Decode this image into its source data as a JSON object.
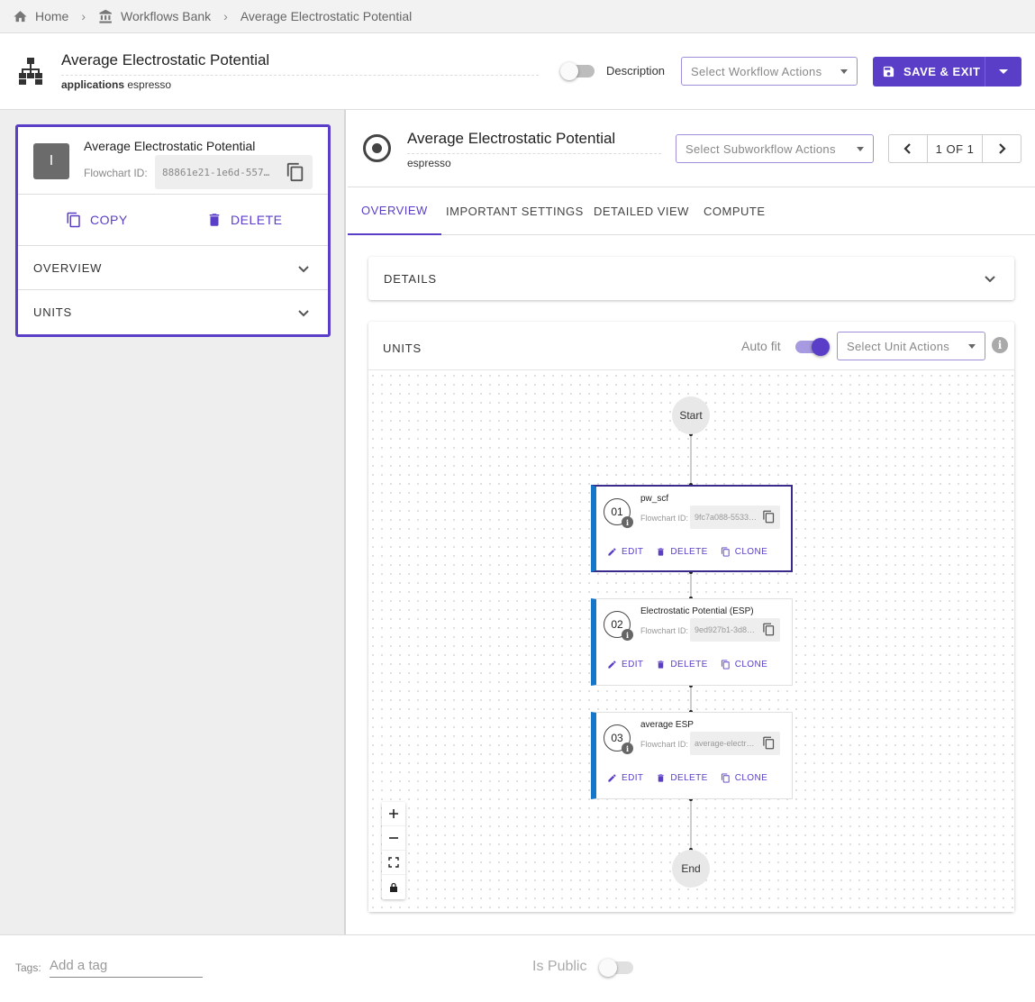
{
  "breadcrumb": {
    "home": "Home",
    "bank": "Workflows Bank",
    "current": "Average Electrostatic Potential"
  },
  "header": {
    "title": "Average Electrostatic Potential",
    "sub_label": "applications",
    "sub_value": "espresso",
    "description_label": "Description",
    "workflow_actions_placeholder": "Select Workflow Actions",
    "save_label": "SAVE & EXIT"
  },
  "left": {
    "card": {
      "avatar": "I",
      "name": "Average Electrostatic Potential",
      "fid_label": "Flowchart ID:",
      "fid_value": "88861e21-1e6d-557…",
      "copy_label": "COPY",
      "delete_label": "DELETE"
    },
    "accordions": [
      "OVERVIEW",
      "UNITS"
    ]
  },
  "subworkflow": {
    "title": "Average Electrostatic Potential",
    "sub": "espresso",
    "actions_placeholder": "Select Subworkflow Actions",
    "pager_text": "1 OF 1"
  },
  "tabs": [
    "OVERVIEW",
    "IMPORTANT SETTINGS",
    "DETAILED VIEW",
    "COMPUTE"
  ],
  "details_label": "DETAILS",
  "units_panel": {
    "label": "UNITS",
    "autofit_label": "Auto fit",
    "autofit_on": true,
    "unit_actions_placeholder": "Select Unit Actions",
    "info": "i",
    "start_label": "Start",
    "end_label": "End",
    "fid_label": "Flowchart ID:",
    "edit_label": "EDIT",
    "delete_label": "DELETE",
    "clone_label": "CLONE",
    "units": [
      {
        "num": "01",
        "name": "pw_scf",
        "fid": "9fc7a088-5533…",
        "selected": true
      },
      {
        "num": "02",
        "name": "Electrostatic Potential (ESP)",
        "fid": "9ed927b1-3d8…",
        "selected": false
      },
      {
        "num": "03",
        "name": "average ESP",
        "fid": "average-electr…",
        "selected": false
      }
    ]
  },
  "footer": {
    "tags_label": "Tags:",
    "tags_placeholder": "Add a tag",
    "public_label": "Is Public"
  },
  "colors": {
    "accent": "#5a3ec8",
    "unit_bar": "#1677c8"
  }
}
